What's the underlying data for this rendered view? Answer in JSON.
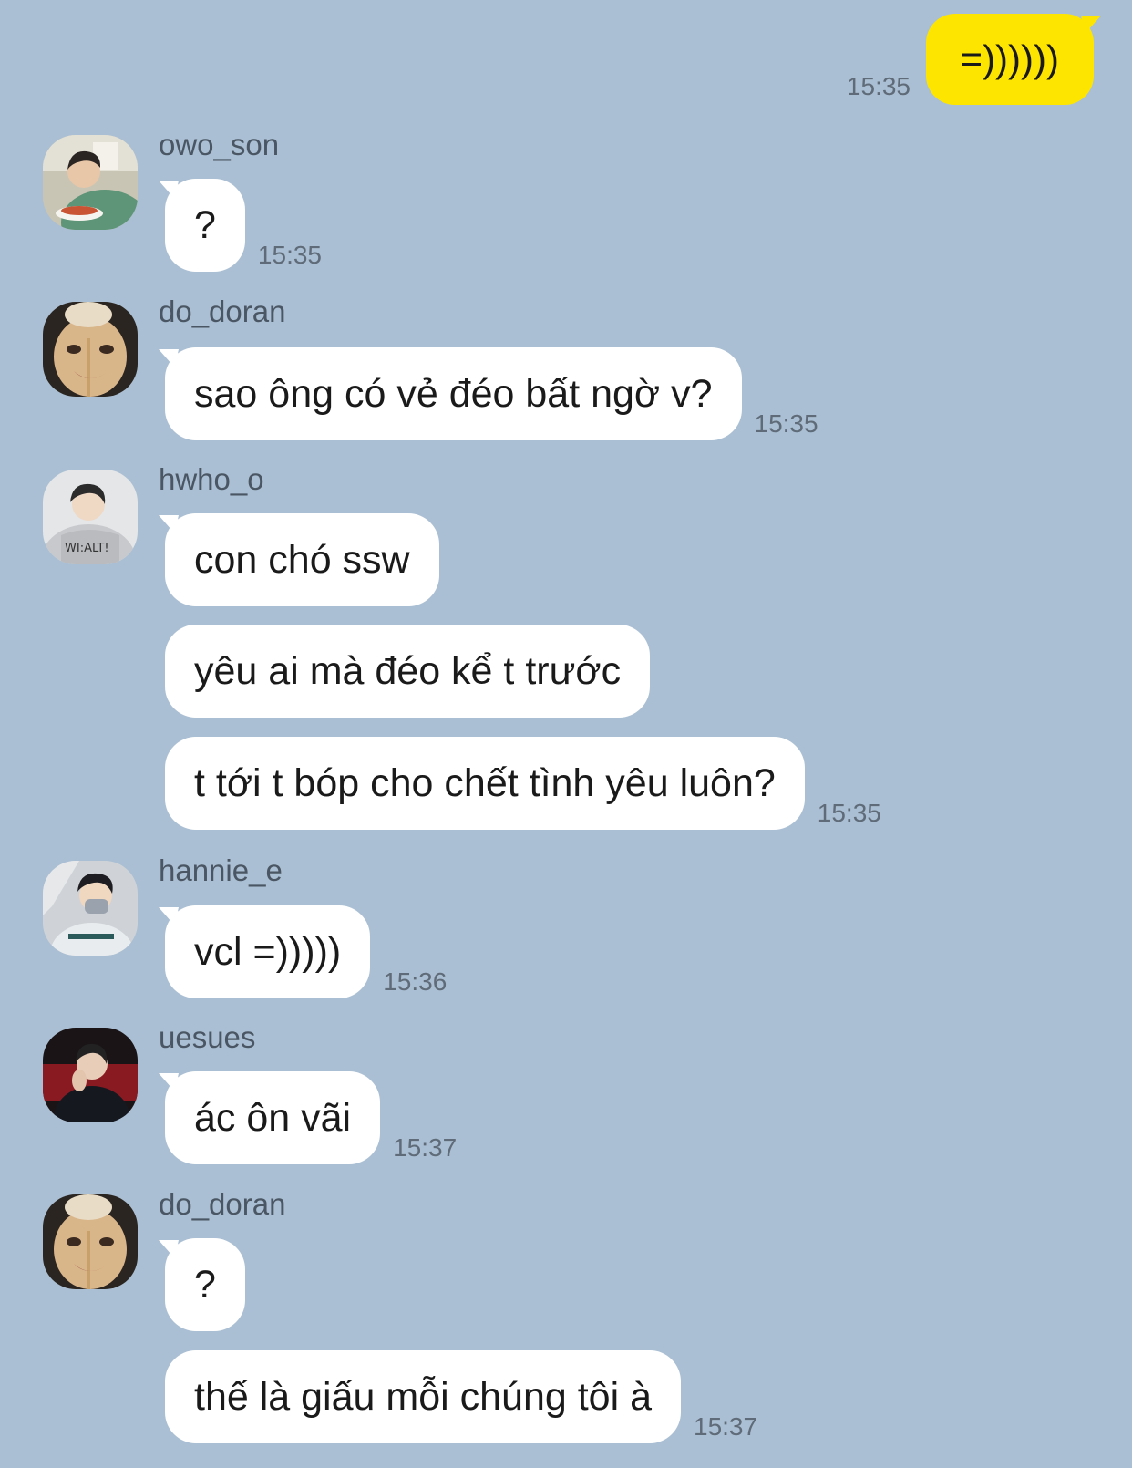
{
  "colors": {
    "background": "#aabfd3",
    "outgoing_bubble": "#fee500",
    "incoming_bubble": "#ffffff",
    "timestamp": "#5f6b78"
  },
  "outgoing": {
    "text": "=))))))",
    "time": "15:35"
  },
  "groups": [
    {
      "sender": "owo_son",
      "avatar": "avatar-owo-son",
      "messages": [
        "?"
      ],
      "time": "15:35"
    },
    {
      "sender": "do_doran",
      "avatar": "avatar-do-doran",
      "messages": [
        "sao ông có vẻ đéo bất ngờ v?"
      ],
      "time": "15:35"
    },
    {
      "sender": "hwho_o",
      "avatar": "avatar-hwho-o",
      "messages": [
        "con chó ssw",
        "yêu ai mà đéo kể t trước",
        "t tới t bóp cho chết tình yêu luôn?"
      ],
      "time": "15:35"
    },
    {
      "sender": "hannie_e",
      "avatar": "avatar-hannie-e",
      "messages": [
        "vcl =)))))"
      ],
      "time": "15:36"
    },
    {
      "sender": "uesues",
      "avatar": "avatar-uesues",
      "messages": [
        "ác ôn vãi"
      ],
      "time": "15:37"
    },
    {
      "sender": "do_doran",
      "avatar": "avatar-do-doran",
      "messages": [
        "?",
        "thế là giấu mỗi chúng tôi à"
      ],
      "time": "15:37"
    }
  ]
}
